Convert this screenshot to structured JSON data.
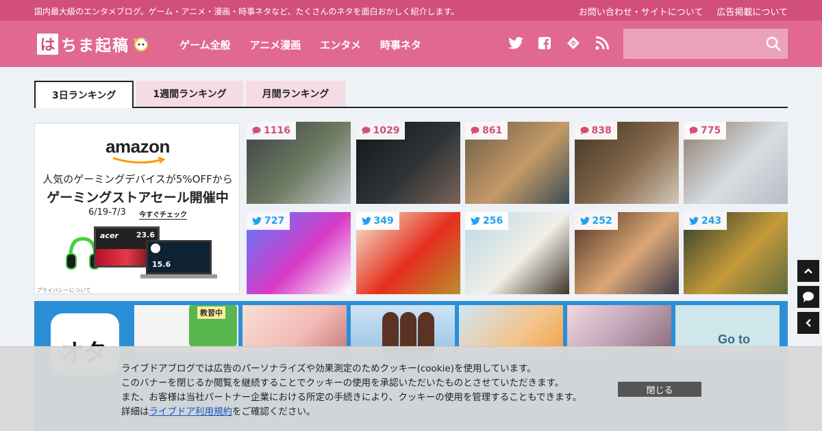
{
  "top_strip": {
    "tagline": "国内最大級のエンタメブログ。ゲーム・アニメ・漫画・時事ネタなど、たくさんのネタを面白おかしく紹介します。",
    "links": [
      "お問い合わせ・サイトについて",
      "広告掲載について"
    ]
  },
  "header": {
    "logo_mark": "は",
    "logo_text": "ちま起稿",
    "nav": [
      "ゲーム全般",
      "アニメ漫画",
      "エンタメ",
      "時事ネタ"
    ],
    "social_icons": [
      "twitter-icon",
      "facebook-icon",
      "feedly-icon",
      "rss-icon"
    ],
    "search_placeholder": ""
  },
  "tabs": [
    {
      "label": "3日ランキング",
      "active": true
    },
    {
      "label": "1週間ランキング",
      "active": false
    },
    {
      "label": "月間ランキング",
      "active": false
    }
  ],
  "ad": {
    "brand": "amazon",
    "line1": "人気のゲーミングデバイスが5%OFFから",
    "line2": "ゲーミングストアセール開催中",
    "dates": "6/19-7/3",
    "cta": "今すぐチェック",
    "monitor_brand": "acer",
    "monitor_size": "23.6",
    "laptop_size": "15.6",
    "privacy": "プライバシーについて"
  },
  "ranking": {
    "comment_row": [
      {
        "count": "1116",
        "palette": [
          "#3b3f46",
          "#6f7c62",
          "#c5c9cf"
        ]
      },
      {
        "count": "1029",
        "palette": [
          "#111417",
          "#2e3438",
          "#7a6458"
        ]
      },
      {
        "count": "861",
        "palette": [
          "#6a5b48",
          "#c49a68",
          "#3b4d56"
        ]
      },
      {
        "count": "838",
        "palette": [
          "#3e3224",
          "#876a4c",
          "#d2c7b7"
        ]
      },
      {
        "count": "775",
        "palette": [
          "#8b7c67",
          "#d8dde2",
          "#b6bdc4"
        ]
      }
    ],
    "tweet_row": [
      {
        "count": "727",
        "palette": [
          "#5c7cfa",
          "#d83ac6",
          "#ffffff"
        ]
      },
      {
        "count": "349",
        "palette": [
          "#f5eed7",
          "#e52e1d",
          "#b8902f"
        ]
      },
      {
        "count": "256",
        "palette": [
          "#b7d9e6",
          "#f2efe8",
          "#3d3428"
        ]
      },
      {
        "count": "252",
        "palette": [
          "#4b2f1f",
          "#dca777",
          "#3a3b4a"
        ]
      },
      {
        "count": "243",
        "palette": [
          "#2e3a2b",
          "#c49a3a",
          "#5f6b3e"
        ]
      }
    ]
  },
  "bottom_banner": {
    "app_text": "オタ",
    "sign_text": "教習中",
    "goto_text": "Go to"
  },
  "cookie": {
    "line1": "ライブドアブログでは広告のパーソナライズや効果測定のためクッキー(cookie)を使用しています。",
    "line2": "このバナーを閉じるか閲覧を継続することでクッキーの使用を承認いただいたものとさせていただきます。",
    "line3": "また、お客様は当社パートナー企業における所定の手続きにより、クッキーの使用を管理することもできます。",
    "line4_pre": "詳細は",
    "line4_link": "ライブドア利用規約",
    "line4_post": "をご確認ください。",
    "close": "閉じる"
  },
  "colors": {
    "brand_dark": "#d24f79",
    "brand": "#e1698f",
    "comment_badge": "#d24f79",
    "tweet_badge": "#1da1f2",
    "banner_blue": "#2a8fd6"
  }
}
